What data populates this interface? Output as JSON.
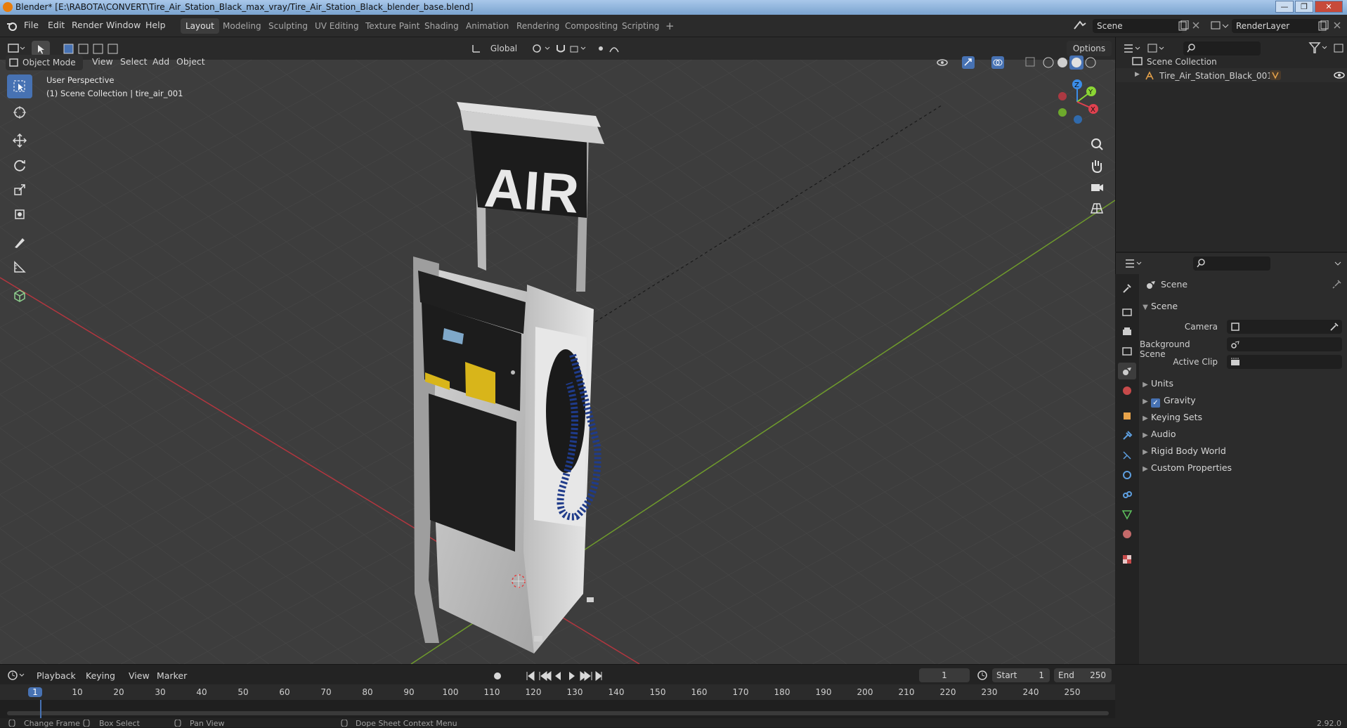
{
  "window": {
    "title": "Blender* [E:\\RABOTA\\CONVERT\\Tire_Air_Station_Black_max_vray/Tire_Air_Station_Black_blender_base.blend]",
    "buttons": [
      "—",
      "❐",
      "✕"
    ]
  },
  "menu": [
    "File",
    "Edit",
    "Render",
    "Window",
    "Help"
  ],
  "workspaces": [
    "Layout",
    "Modeling",
    "Sculpting",
    "UV Editing",
    "Texture Paint",
    "Shading",
    "Animation",
    "Rendering",
    "Compositing",
    "Scripting"
  ],
  "workspace_active": "Layout",
  "workspace_add": "+",
  "scene_field": "Scene",
  "renderlayer_field": "RenderLayer",
  "viewport_header": {
    "mode": "Object Mode",
    "menus": [
      "View",
      "Select",
      "Add",
      "Object"
    ],
    "transform_orientation": "Global",
    "options": "Options"
  },
  "viewport": {
    "overlay_line1": "User Perspective",
    "overlay_line2": "(1) Scene Collection | tire_air_001",
    "sign_text": "AIR",
    "gizmo_axes": [
      "Z",
      "Y",
      "X"
    ]
  },
  "tools": [
    "select-box",
    "cursor",
    "move",
    "rotate",
    "scale",
    "transform",
    "annotate",
    "measure",
    "add-cube"
  ],
  "outliner": {
    "root": "Scene Collection",
    "items": [
      "Tire_Air_Station_Black_001"
    ]
  },
  "properties": {
    "context_title": "Scene",
    "panel_title": "Scene",
    "fields": [
      {
        "label": "Camera",
        "value": ""
      },
      {
        "label": "Background Scene",
        "value": ""
      },
      {
        "label": "Active Clip",
        "value": ""
      }
    ],
    "sections": [
      "Units",
      "Gravity",
      "Keying Sets",
      "Audio",
      "Rigid Body World",
      "Custom Properties"
    ],
    "gravity_checked": true
  },
  "timeline": {
    "menus": [
      "Playback",
      "Keying",
      "View",
      "Marker"
    ],
    "current_frame": "1",
    "start_label": "Start",
    "start": "1",
    "end_label": "End",
    "end": "250",
    "frame_labels": [
      "1",
      "10",
      "20",
      "30",
      "40",
      "50",
      "60",
      "70",
      "80",
      "90",
      "100",
      "110",
      "120",
      "130",
      "140",
      "150",
      "160",
      "170",
      "180",
      "190",
      "200",
      "210",
      "220",
      "230",
      "240",
      "250"
    ]
  },
  "statusbar": {
    "items": [
      "Change Frame",
      "Box Select",
      "Pan View",
      "Dope Sheet Context Menu"
    ],
    "version": "2.92.0"
  },
  "colors": {
    "accent": "#4772b3",
    "axis_x": "#e0414f",
    "axis_y": "#8bd634",
    "axis_z": "#3b8de8",
    "timeline_cursor": "#4772b3"
  }
}
